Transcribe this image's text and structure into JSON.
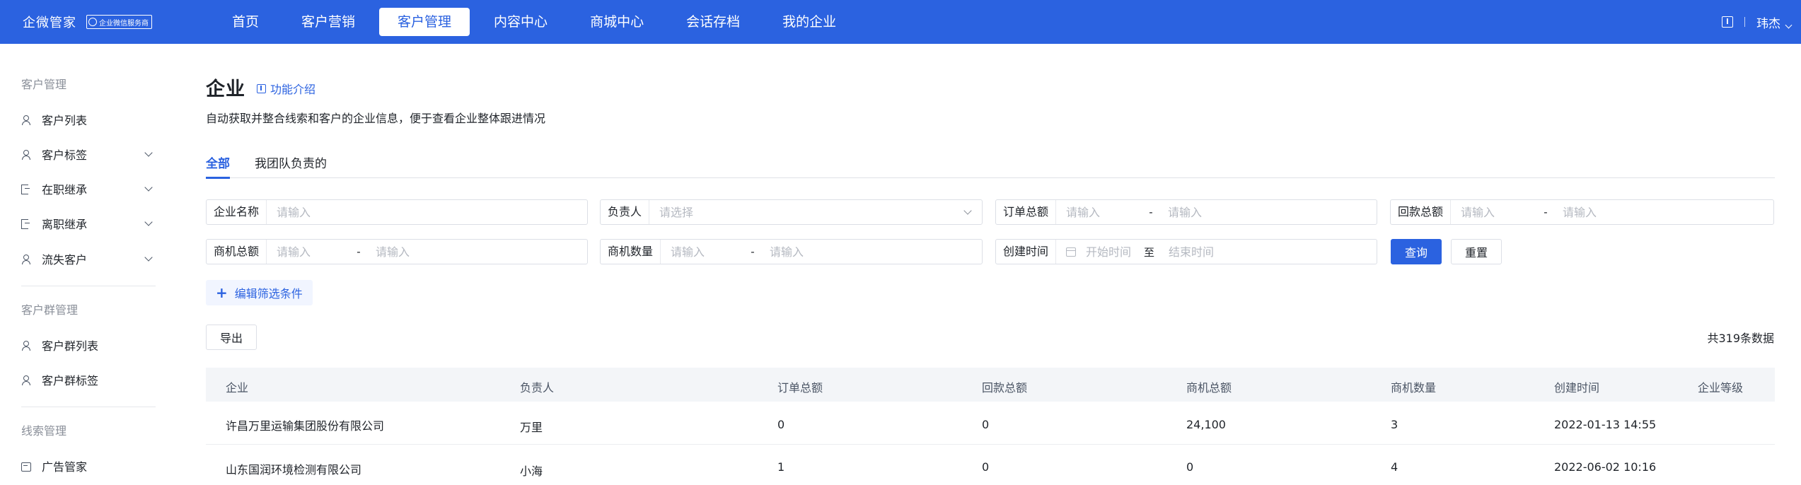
{
  "topbar": {
    "brand": "企微管家",
    "badge": "企业微信服务商",
    "nav": [
      "首页",
      "客户营销",
      "客户管理",
      "内容中心",
      "商城中心",
      "会话存档",
      "我的企业"
    ],
    "active_nav": "客户管理",
    "user": "玮杰"
  },
  "sidebar": {
    "group1": "客户管理",
    "item_customer_list": "客户列表",
    "item_customer_tags": "客户标签",
    "item_onjob": "在职继承",
    "item_offjob": "离职继承",
    "item_lost": "流失客户",
    "group2": "客户群管理",
    "item_group_list": "客户群列表",
    "item_group_tags": "客户群标签",
    "group3": "线索管理",
    "item_ads": "广告管家"
  },
  "page": {
    "title": "企业",
    "intro": "功能介绍",
    "desc": "自动获取并整合线索和客户的企业信息，便于查看企业整体跟进情况"
  },
  "tabs": {
    "all": "全部",
    "team": "我团队负责的"
  },
  "filters": {
    "company_label": "企业名称",
    "owner_label": "负责人",
    "order_label": "订单总额",
    "payment_label": "回款总额",
    "opp_amount_label": "商机总额",
    "opp_count_label": "商机数量",
    "created_label": "创建时间",
    "input_placeholder": "请输入",
    "select_placeholder": "请选择",
    "start_placeholder": "开始时间",
    "end_placeholder": "结束时间",
    "range_dash": "-",
    "range_to": "至"
  },
  "actions": {
    "query": "查询",
    "reset": "重置",
    "edit_filter": "编辑筛选条件",
    "export": "导出",
    "total": "共319条数据"
  },
  "table": {
    "headers": {
      "company": "企业",
      "owner": "负责人",
      "order": "订单总额",
      "payment": "回款总额",
      "opp_amount": "商机总额",
      "opp_count": "商机数量",
      "created": "创建时间",
      "level": "企业等级"
    },
    "rows": [
      {
        "company": "许昌万里运输集团股份有限公司",
        "owner": "万里",
        "order": "0",
        "payment": "0",
        "opp_amount": "24,100",
        "opp_count": "3",
        "created": "2022-01-13 14:55",
        "level": ""
      },
      {
        "company": "山东国润环境检测有限公司",
        "owner": "小海",
        "order": "1",
        "payment": "0",
        "opp_amount": "0",
        "opp_count": "4",
        "created": "2022-06-02 10:16",
        "level": ""
      }
    ]
  },
  "colors": {
    "primary": "#2b62e0",
    "header_bg": "#2b62e0",
    "table_head_bg": "#f3f5f8"
  }
}
